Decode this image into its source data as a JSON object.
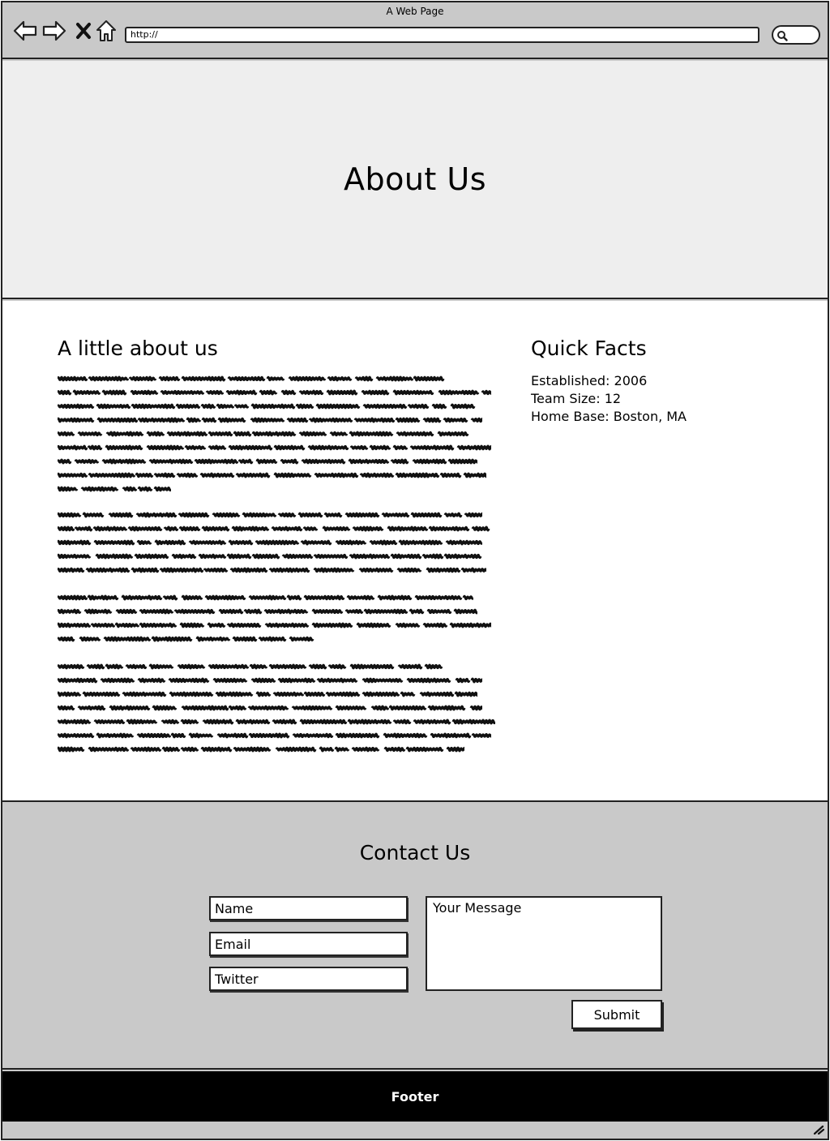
{
  "browser": {
    "title": "A Web Page",
    "url": "http://",
    "icons": [
      "back-arrow-icon",
      "forward-arrow-icon",
      "close-x-icon",
      "home-icon",
      "search-icon"
    ]
  },
  "hero": {
    "title": "About Us"
  },
  "about": {
    "title": "A little about us",
    "paragraphs": [
      {
        "line_fills": [
          0.89,
          0.99,
          0.96,
          0.97,
          0.95,
          0.99,
          0.96,
          0.98,
          0.26
        ]
      },
      {
        "line_fills": [
          0.97,
          0.99,
          0.97,
          0.98,
          0.98
        ]
      },
      {
        "line_fills": [
          0.95,
          0.96,
          0.99,
          0.6
        ]
      },
      {
        "line_fills": [
          0.88,
          0.97,
          0.96,
          0.97,
          1.0,
          0.99,
          0.93
        ]
      }
    ]
  },
  "facts": {
    "title": "Quick Facts",
    "items": [
      "Established: 2006",
      "Team Size: 12",
      "Home Base: Boston, MA"
    ]
  },
  "contact": {
    "title": "Contact Us",
    "name_placeholder": "Name",
    "email_placeholder": "Email",
    "twitter_placeholder": "Twitter",
    "message_placeholder": "Your Message",
    "submit_label": "Submit"
  },
  "footer": {
    "label": "Footer"
  },
  "colors": {
    "hero_bg": "#eeeeee",
    "chrome_bg": "#c9c9c9",
    "footer_bg": "#000000"
  }
}
